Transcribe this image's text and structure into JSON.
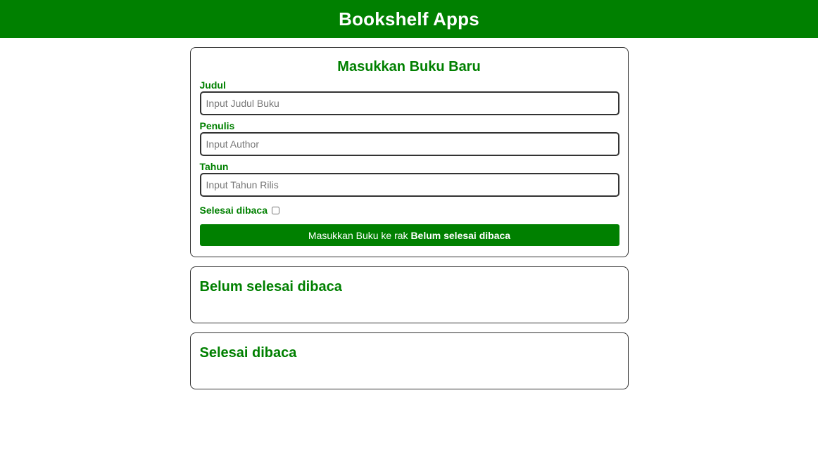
{
  "header": {
    "title": "Bookshelf Apps"
  },
  "input_section": {
    "title": "Masukkan Buku Baru",
    "fields": {
      "title": {
        "label": "Judul",
        "placeholder": "Input Judul Buku",
        "value": ""
      },
      "author": {
        "label": "Penulis",
        "placeholder": "Input Author",
        "value": ""
      },
      "year": {
        "label": "Tahun",
        "placeholder": "Input Tahun Rilis",
        "value": ""
      }
    },
    "complete_checkbox": {
      "label": "Selesai dibaca",
      "checked": false
    },
    "submit": {
      "prefix": "Masukkan Buku ke rak ",
      "shelf": "Belum selesai dibaca"
    }
  },
  "shelves": {
    "incomplete": {
      "title": "Belum selesai dibaca",
      "books": []
    },
    "complete": {
      "title": "Selesai dibaca",
      "books": []
    }
  },
  "colors": {
    "primary": "#008000",
    "border": "#333333",
    "background": "#ffffff"
  }
}
